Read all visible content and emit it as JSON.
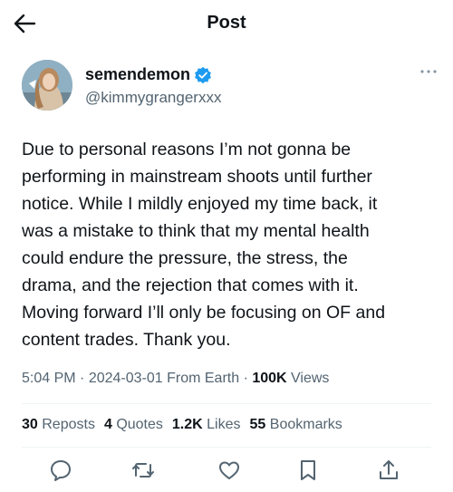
{
  "header": {
    "title": "Post"
  },
  "author": {
    "display_name": "semendemon",
    "handle": "@kimmygrangerxxx"
  },
  "tweet": {
    "text": "Due to personal reasons I’m not gonna be\nperforming in mainstream shoots until further\nnotice. While I mildly enjoyed my time back, it\nwas a mistake to think that my mental health\ncould endure the pressure, the stress, the\ndrama, and the rejection that comes with it.\nMoving forward I’ll only be focusing on OF and\ncontent trades. Thank you."
  },
  "meta": {
    "time": "5:04 PM",
    "sep1": " · ",
    "date": "2024-03-01",
    "source": " From Earth",
    "sep2": " · ",
    "views_count": "100K",
    "views_label": " Views"
  },
  "stats": {
    "reposts_count": "30",
    "reposts_label": "Reposts",
    "quotes_count": "4",
    "quotes_label": "Quotes",
    "likes_count": "1.2K",
    "likes_label": "Likes",
    "bookmarks_count": "55",
    "bookmarks_label": "Bookmarks"
  },
  "icons": {
    "back": "arrow-left-icon",
    "verified": "verified-badge-icon",
    "more": "more-dots-icon",
    "reply": "reply-icon",
    "repost": "repost-icon",
    "like": "heart-icon",
    "bookmark": "bookmark-icon",
    "share": "share-icon"
  },
  "colors": {
    "verified": "#1d9bf0",
    "secondary_text": "#536471",
    "primary_text": "#0f1419"
  }
}
